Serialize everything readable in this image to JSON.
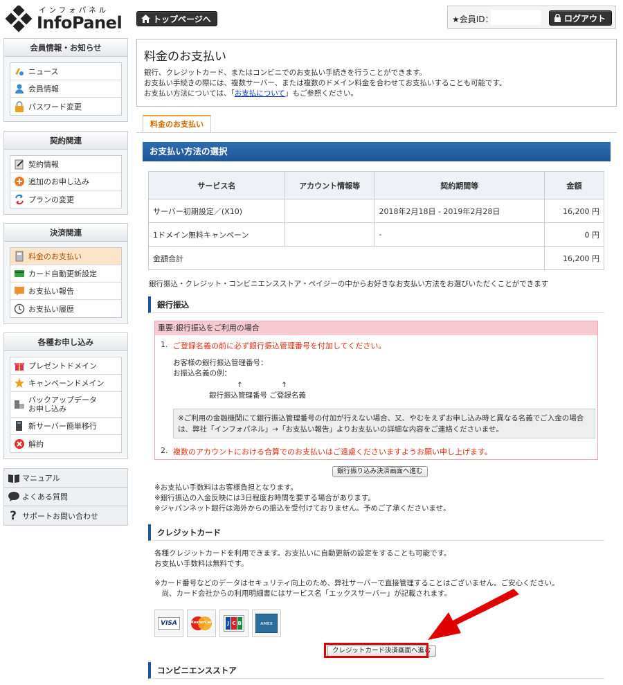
{
  "header": {
    "logo_kana": "インフォパネル",
    "logo_text": "InfoPanel",
    "top_button": "トップページへ",
    "member_label": "★会員ID：",
    "member_id_value": "",
    "logout_button": "ログアウト"
  },
  "sidebar": {
    "groups": [
      {
        "title": "会員情報・お知らせ",
        "items": [
          "ニュース",
          "会員情報",
          "パスワード変更"
        ]
      },
      {
        "title": "契約関連",
        "items": [
          "契約情報",
          "追加のお申し込み",
          "プランの変更"
        ]
      },
      {
        "title": "決済関連",
        "items": [
          "料金のお支払い",
          "カード自動更新設定",
          "お支払い報告",
          "お支払い履歴"
        ]
      },
      {
        "title": "各種お申し込み",
        "items": [
          "プレゼントドメイン",
          "キャンペーンドメイン",
          "バックアップデータ",
          "お申し込み",
          "新サーバー簡単移行",
          "解約"
        ]
      }
    ],
    "links": [
      "マニュアル",
      "よくある質問",
      "サポートお問い合わせ"
    ]
  },
  "intro": {
    "title": "料金のお支払い",
    "line1": "銀行、クレジットカード、またはコンビニでのお支払い手続きを行うことができます。",
    "line2": "お支払い手続きの際には、複数サーバー、または複数のドメイン料金を合わせてお支払いすることも可能です。",
    "line3_pre": "お支払い方法については、「",
    "line3_link": "お支払について",
    "line3_post": "」もご参照ください。"
  },
  "tab_label": "料金のお支払い",
  "section_title": "お支払い方法の選択",
  "fee_table": {
    "headers": [
      "サービス名",
      "アカウント情報等",
      "契約期間等",
      "金額"
    ],
    "rows": [
      [
        "サーバー初期設定／(X10)",
        "",
        "2018年2月18日 - 2019年2月28日",
        "16,200 円"
      ],
      [
        "1ドメイン無料キャンペーン",
        "",
        "-",
        "0 円"
      ]
    ],
    "total_label": "金額合計",
    "total_value": "16,200 円"
  },
  "methods_note": "銀行振込・クレジット・コンビニエンスストア・ペイジーの中からお好きなお支払い方法をお選びいただくことができます",
  "bank": {
    "title": "銀行振込",
    "warn_head": "重要:銀行振込をご利用の場合",
    "num1": "1.",
    "item1": "ご登録名義の前に必ず銀行振込管理番号を付加してください。",
    "mgmt_no": "お客様の銀行振込管理番号：",
    "example": "お振込名義の例：",
    "arrow1": "↑",
    "arrow2": "↑",
    "label_mgmt": "銀行振込管理番号",
    "label_name": "ご登録名義",
    "gray_line1": "※ご利用の金融機関にて銀行振込管理番号の付加が行えない場合、又、やむをえずお申し込み時と異なる名義でご入金の場合",
    "gray_line2": "は、弊社「インフォパネル」→「お支払い報告」よりお支払いの詳細な内容をご連絡くださいませ。",
    "num2": "2.",
    "item2": "複数のアカウントにおける合算でのお支払いはご遠慮くださいますようお願い申し上げます。",
    "button": "銀行振り込み決済画面へ進む",
    "notes": [
      "※お支払い手数料はお客様負担となります。",
      "※銀行振込の入金反映には3日程度お時間を要する場合があります。",
      "※ジャパンネット銀行は海外からの振込を受付けておりません。予めご了承くださいませ。"
    ]
  },
  "credit": {
    "title": "クレジットカード",
    "line1": "各種クレジットカードを利用できます。お支払いに自動更新の設定をすることも可能です。",
    "line2": "お支払い手数料は無料です。",
    "note1": "※カード番号などのデータはセキュリティ向上のため、弊社サーバーで直接管理することはございません。ご安心ください。",
    "note2": "　尚、カード会社からの利用明細書にはサービス名「エックスサーバー」が記載されます。",
    "cards": [
      "VISA",
      "MasterCard",
      "JCB",
      "AMEX"
    ],
    "button": "クレジットカード決済画面へ進む"
  },
  "convenience": {
    "title": "コンビニエンスストア"
  },
  "colors": {
    "accent": "#1f5597",
    "highlight": "#e00000",
    "active": "#fce4c8"
  }
}
